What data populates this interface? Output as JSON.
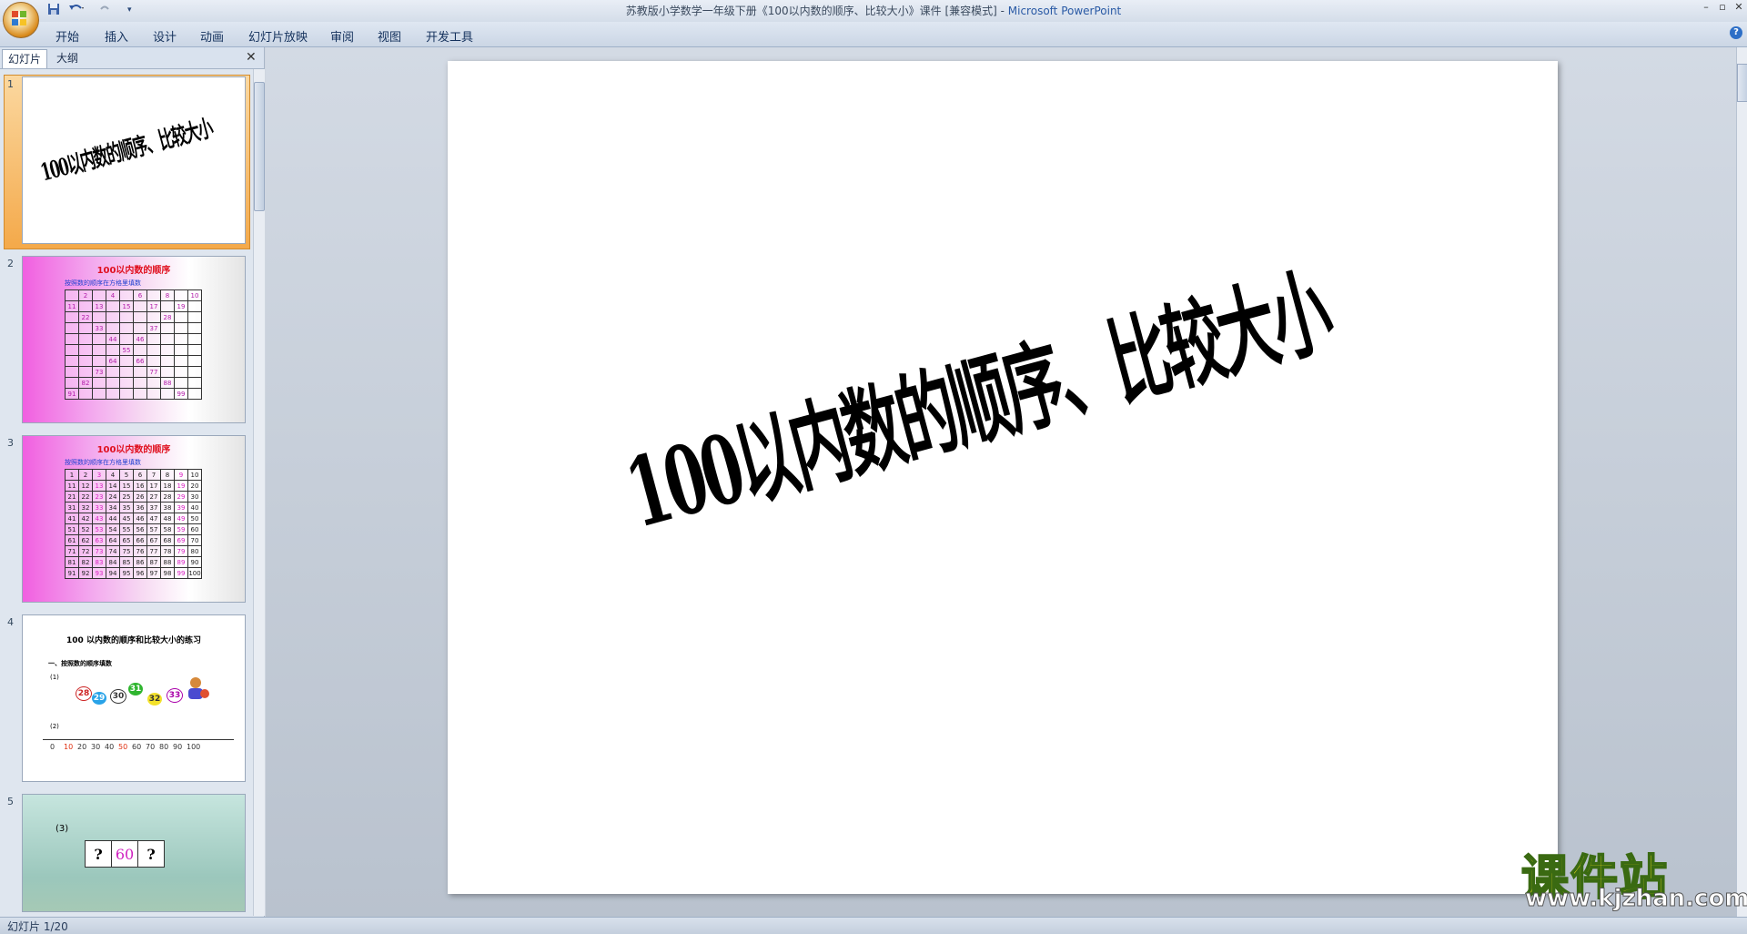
{
  "window": {
    "title_doc": "苏教版小学数学一年级下册《100以内数的顺序、比较大小》课件 [兼容模式] - ",
    "title_app": "Microsoft PowerPoint",
    "controls": [
      "–",
      "▫",
      "✕"
    ]
  },
  "quick_access": [
    "save-icon",
    "undo-icon",
    "redo-icon",
    "customize-icon"
  ],
  "ribbon_tabs": [
    "开始",
    "插入",
    "设计",
    "动画",
    "幻灯片放映",
    "审阅",
    "视图",
    "开发工具"
  ],
  "left_pane": {
    "tabs": [
      "幻灯片",
      "大纲"
    ],
    "close": "✕",
    "slides": [
      {
        "num": "1",
        "title": "100以内数的顺序、比较大小"
      },
      {
        "num": "2",
        "title": "100以内数的顺序",
        "subtitle": "按照数的顺序在方格里填数",
        "grid": [
          [
            "",
            "2",
            "",
            "4",
            "",
            "6",
            "",
            "8",
            "",
            "10"
          ],
          [
            "11",
            "",
            "13",
            "",
            "15",
            "",
            "17",
            "",
            "19",
            ""
          ],
          [
            "",
            "22",
            "",
            "",
            "",
            "",
            "",
            "28",
            "",
            ""
          ],
          [
            "",
            "",
            "33",
            "",
            "",
            "",
            "37",
            "",
            "",
            ""
          ],
          [
            "",
            "",
            "",
            "44",
            "",
            "46",
            "",
            "",
            "",
            ""
          ],
          [
            "",
            "",
            "",
            "",
            "55",
            "",
            "",
            "",
            "",
            ""
          ],
          [
            "",
            "",
            "",
            "64",
            "",
            "66",
            "",
            "",
            "",
            ""
          ],
          [
            "",
            "",
            "73",
            "",
            "",
            "",
            "77",
            "",
            "",
            ""
          ],
          [
            "",
            "82",
            "",
            "",
            "",
            "",
            "",
            "88",
            "",
            ""
          ],
          [
            "91",
            "",
            "",
            "",
            "",
            "",
            "",
            "",
            "99",
            ""
          ]
        ]
      },
      {
        "num": "3",
        "title": "100以内数的顺序",
        "subtitle": "按照数的顺序在方格里填数",
        "grid": [
          [
            "1",
            "2",
            "3",
            "4",
            "5",
            "6",
            "7",
            "8",
            "9",
            "10"
          ],
          [
            "11",
            "12",
            "13",
            "14",
            "15",
            "16",
            "17",
            "18",
            "19",
            "20"
          ],
          [
            "21",
            "22",
            "23",
            "24",
            "25",
            "26",
            "27",
            "28",
            "29",
            "30"
          ],
          [
            "31",
            "32",
            "33",
            "34",
            "35",
            "36",
            "37",
            "38",
            "39",
            "40"
          ],
          [
            "41",
            "42",
            "43",
            "44",
            "45",
            "46",
            "47",
            "48",
            "49",
            "50"
          ],
          [
            "51",
            "52",
            "53",
            "54",
            "55",
            "56",
            "57",
            "58",
            "59",
            "60"
          ],
          [
            "61",
            "62",
            "63",
            "64",
            "65",
            "66",
            "67",
            "68",
            "69",
            "70"
          ],
          [
            "71",
            "72",
            "73",
            "74",
            "75",
            "76",
            "77",
            "78",
            "79",
            "80"
          ],
          [
            "81",
            "82",
            "83",
            "84",
            "85",
            "86",
            "87",
            "88",
            "89",
            "90"
          ],
          [
            "91",
            "92",
            "93",
            "94",
            "95",
            "96",
            "97",
            "98",
            "99",
            "100"
          ]
        ]
      },
      {
        "num": "4",
        "title": "100 以内数的顺序和比较大小的练习",
        "subtitle": "一、按照数的顺序填数",
        "label1": "(1)",
        "label2": "(2)",
        "balls": [
          "28",
          "29",
          "30",
          "31",
          "32",
          "33"
        ],
        "numline": [
          "0",
          "10",
          "20",
          "30",
          "40",
          "50",
          "60",
          "70",
          "80",
          "90",
          "100"
        ]
      },
      {
        "num": "5",
        "label": "(3)",
        "boxes": [
          "?",
          "60",
          "?"
        ]
      }
    ]
  },
  "slide": {
    "title": "100以内数的顺序、比较大小"
  },
  "watermark": {
    "cn": "课件站",
    "url": "www.kjzhan.com"
  },
  "status": {
    "text": "幻灯片 1/20"
  },
  "colors": {
    "accent": "#2a5aa5",
    "selection": "#f4a94a",
    "pink": "#f15fe0"
  }
}
